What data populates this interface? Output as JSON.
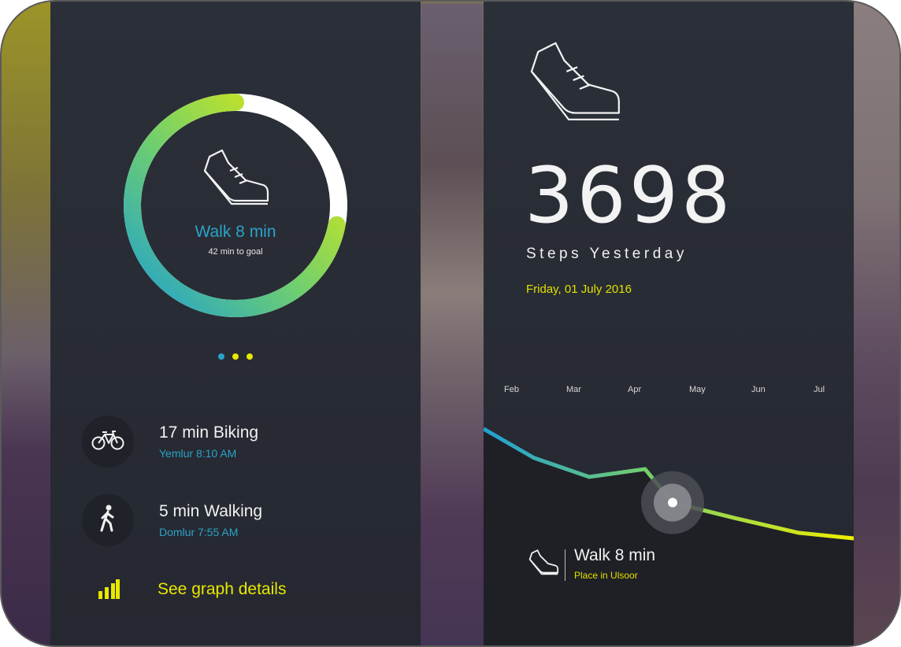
{
  "colors": {
    "accent_blue": "#2aa3c9",
    "accent_yellow": "#e8e800",
    "panel_bg": "#2b2f38",
    "text_light": "#f1f1f1"
  },
  "left_panel": {
    "ring": {
      "title": "Walk 8 min",
      "subtitle": "42 min to goal",
      "progress_fraction": 0.72,
      "icon": "shoe-icon"
    },
    "pager": {
      "count": 3,
      "active_index": 0
    },
    "activities": [
      {
        "title": "17 min Biking",
        "subtitle": "Yemlur 8:10 AM",
        "icon": "bicycle-icon"
      },
      {
        "title": "5 min Walking",
        "subtitle": "Domlur 7:55 AM",
        "icon": "walking-person-icon"
      }
    ],
    "graph_link": {
      "label": "See graph details",
      "icon": "bar-chart-icon"
    }
  },
  "right_panel": {
    "icon": "shoe-icon",
    "steps_value": "3698",
    "steps_label": "Steps Yesterday",
    "date": "Friday, 01 July 2016",
    "chart_data": {
      "type": "line",
      "x": [
        "Feb",
        "Mar",
        "Apr",
        "May",
        "Jun",
        "Jul"
      ],
      "y_relative": [
        0.98,
        0.72,
        0.55,
        0.62,
        0.32,
        0.18,
        0.05,
        0.0
      ],
      "highlighted_point_index": 4
    },
    "selected": {
      "title": "Walk 8 min",
      "subtitle": "Place in Ulsoor",
      "icon": "shoe-icon"
    }
  }
}
